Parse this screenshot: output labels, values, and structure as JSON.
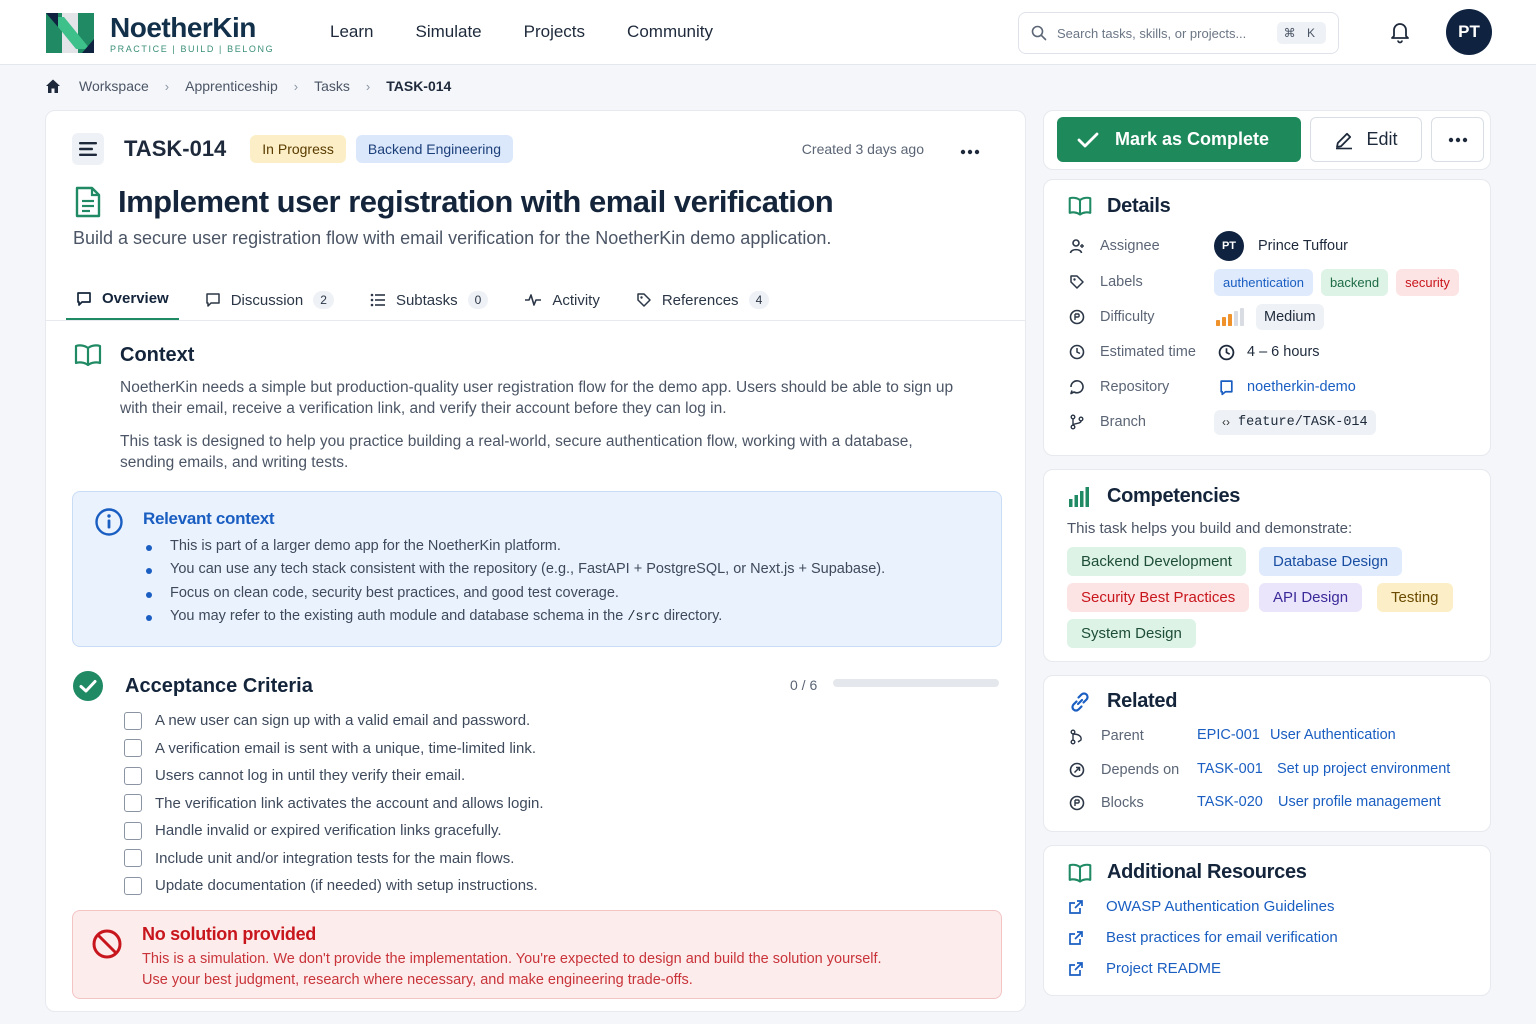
{
  "brand": {
    "name": "NoetherKin",
    "tagline": "PRACTICE | BUILD | BELONG"
  },
  "nav": [
    "Learn",
    "Simulate",
    "Projects",
    "Community"
  ],
  "search": {
    "placeholder": "Search tasks, skills, or projects...",
    "shortcut": "⌘ K"
  },
  "user": {
    "initials": "PT"
  },
  "breadcrumb": [
    "Workspace",
    "Apprenticeship",
    "Tasks",
    "TASK-014"
  ],
  "task": {
    "id": "TASK-014",
    "status": "In Progress",
    "team": "Backend Engineering",
    "created": "Created 3 days ago",
    "title": "Implement user registration with email verification",
    "subtitle": "Build a secure user registration flow with email verification for the NoetherKin demo application."
  },
  "tabs": [
    {
      "label": "Overview",
      "count": null
    },
    {
      "label": "Discussion",
      "count": "2"
    },
    {
      "label": "Subtasks",
      "count": "0"
    },
    {
      "label": "Activity",
      "count": null
    },
    {
      "label": "References",
      "count": "4"
    }
  ],
  "context": {
    "title": "Context",
    "p1": "NoetherKin needs a simple but production-quality user registration flow for the demo app. Users should be able to sign up with their email, receive a verification link, and verify their account before they can log in.",
    "p2": "This task is designed to help you practice building a real-world, secure authentication flow, working with a database, sending emails, and writing tests."
  },
  "relevant": {
    "title": "Relevant context",
    "items": [
      "This is part of a larger demo app for the NoetherKin platform.",
      "You can use any tech stack consistent with the repository (e.g., FastAPI + PostgreSQL, or Next.js + Supabase).",
      "Focus on clean code, security best practices, and good test coverage."
    ],
    "item4_pre": "You may refer to the existing auth module and database schema in the",
    "item4_code": "/src",
    "item4_post": "directory."
  },
  "acceptance": {
    "title": "Acceptance Criteria",
    "progress_text": "0 / 6",
    "progress": 0,
    "items": [
      "A new user can sign up with a valid email and password.",
      "A verification email is sent with a unique, time-limited link.",
      "Users cannot log in until they verify their email.",
      "The verification link activates the account and allows login.",
      "Handle invalid or expired verification links gracefully.",
      "Include unit and/or integration tests for the main flows.",
      "Update documentation (if needed) with setup instructions."
    ]
  },
  "warning": {
    "title": "No solution provided",
    "line1": "This is a simulation. We don't provide the implementation. You're expected to design and build the solution yourself.",
    "line2": "Use your best judgment, research where necessary, and make engineering trade-offs."
  },
  "actions": {
    "complete": "Mark as Complete",
    "edit": "Edit"
  },
  "details": {
    "title": "Details",
    "assignee_label": "Assignee",
    "assignee_initials": "PT",
    "assignee_name": "Prince Tuffour",
    "labels_label": "Labels",
    "labels": [
      "authentication",
      "backend",
      "security"
    ],
    "difficulty_label": "Difficulty",
    "difficulty": "Medium",
    "difficulty_level": 3,
    "difficulty_max": 5,
    "time_label": "Estimated time",
    "time": "4 – 6 hours",
    "repo_label": "Repository",
    "repo": "noetherkin-demo",
    "branch_label": "Branch",
    "branch": "feature/TASK-014"
  },
  "competencies": {
    "title": "Competencies",
    "subtitle": "This task helps you build and demonstrate:",
    "items": [
      "Backend Development",
      "Database Design",
      "Security Best Practices",
      "API Design",
      "Testing",
      "System Design"
    ]
  },
  "related": {
    "title": "Related",
    "rows": [
      {
        "label": "Parent",
        "id": "EPIC-001",
        "name": "User Authentication"
      },
      {
        "label": "Depends on",
        "id": "TASK-001",
        "name": "Set up project environment"
      },
      {
        "label": "Blocks",
        "id": "TASK-020",
        "name": "User profile management"
      }
    ]
  },
  "resources": {
    "title": "Additional Resources",
    "items": [
      "OWASP Authentication Guidelines",
      "Best practices for email verification",
      "Project README"
    ]
  },
  "colors": {
    "accent": "#1e8a5c",
    "link": "#1a5ec2",
    "danger": "#c8161d",
    "navy": "#0f2340"
  }
}
